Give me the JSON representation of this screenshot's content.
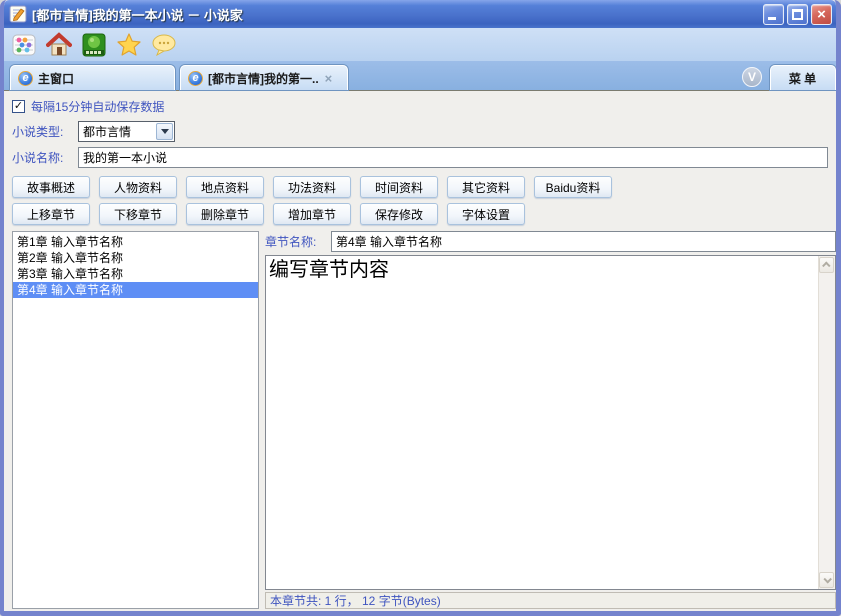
{
  "colors": {
    "titlebar_blue": "#4a72cc",
    "frame_purple": "#7483cd",
    "toolbar_bg": "#c3d8f2",
    "tabbar_bg": "#8db4e2",
    "tab_bg": "#c7dcf4",
    "content_bg": "#f0efec",
    "label_blue": "#3f54bf",
    "selection_blue": "#5e8ef5",
    "close_red": "#d6675c"
  },
  "window": {
    "title": "[都市言情]我的第一本小说 － 小说家",
    "controls": [
      "minimize",
      "maximize",
      "close"
    ],
    "close_glyph": "×"
  },
  "toolbar": {
    "icons": [
      "abacus",
      "home",
      "plant",
      "star",
      "chat-bubble"
    ]
  },
  "tab_bar": {
    "tab_icon_glyph": "e",
    "tabs": [
      {
        "label": "主窗口"
      },
      {
        "label": "[都市言情]我的第一..",
        "close_glyph": "×"
      }
    ],
    "v_button": "V",
    "menu_button": "菜 单"
  },
  "settings": {
    "autosave_label": "每隔15分钟自动保存数据",
    "autosave_checked": true,
    "check_glyph": "✓",
    "novel_type_label": "小说类型:",
    "novel_type_value": "都市言情",
    "novel_name_label": "小说名称:",
    "novel_name_value": "我的第一本小说"
  },
  "resource_buttons": [
    "故事概述",
    "人物资料",
    "地点资料",
    "功法资料",
    "时间资料",
    "其它资料",
    "Baidu资料"
  ],
  "chapter_buttons": [
    "上移章节",
    "下移章节",
    "删除章节",
    "增加章节",
    "保存修改",
    "字体设置"
  ],
  "chapter_list": [
    {
      "label": "第1章 输入章节名称",
      "selected": false
    },
    {
      "label": "第2章 输入章节名称",
      "selected": false
    },
    {
      "label": "第3章 输入章节名称",
      "selected": false
    },
    {
      "label": "第4章 输入章节名称",
      "selected": true
    }
  ],
  "editor": {
    "chapter_name_label": "章节名称:",
    "chapter_name_value": "第4章 输入章节名称",
    "content_text": "编写章节内容",
    "status_text": "本章节共: 1 行， 12 字节(Bytes)"
  }
}
